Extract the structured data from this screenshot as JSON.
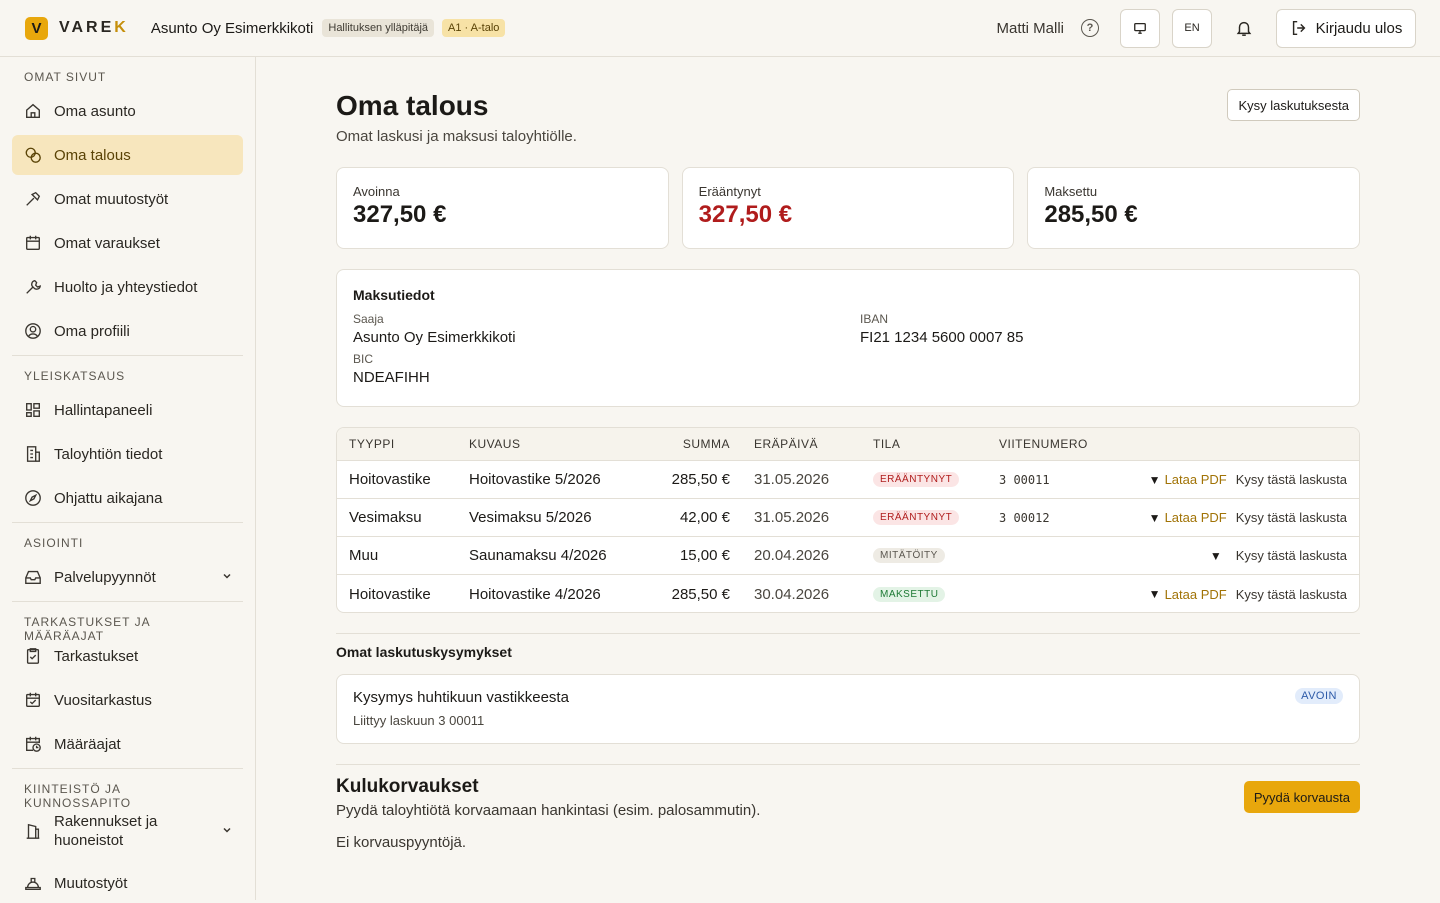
{
  "header": {
    "logo_letter": "V",
    "logo_text_main": "VARE",
    "logo_text_accent": "K",
    "org_name": "Asunto Oy Esimerkkikoti",
    "role_badge": "Hallituksen ylläpitäjä",
    "apartment_badge": "A1 · A-talo",
    "user_name": "Matti Malli",
    "help_icon": "?",
    "language": "EN",
    "logout_label": "Kirjaudu ulos"
  },
  "sidebar": {
    "sections": [
      {
        "title": "OMAT SIVUT",
        "items": [
          {
            "label": "Oma asunto",
            "icon": "home-icon"
          },
          {
            "label": "Oma talous",
            "icon": "coins-icon",
            "active": true
          },
          {
            "label": "Omat muutostyöt",
            "icon": "hammer-icon"
          },
          {
            "label": "Omat varaukset",
            "icon": "calendar-icon"
          },
          {
            "label": "Huolto ja yhteystiedot",
            "icon": "wrench-icon"
          },
          {
            "label": "Oma profiili",
            "icon": "user-circle-icon"
          }
        ]
      },
      {
        "title": "YLEISKATSAUS",
        "items": [
          {
            "label": "Hallintapaneeli",
            "icon": "dashboard-icon"
          },
          {
            "label": "Taloyhtiön tiedot",
            "icon": "building-icon"
          },
          {
            "label": "Ohjattu aikajana",
            "icon": "compass-icon"
          }
        ]
      },
      {
        "title": "ASIOINTI",
        "items": [
          {
            "label": "Palvelupyynnöt",
            "icon": "inbox-icon",
            "expandable": true
          }
        ]
      },
      {
        "title": "TARKASTUKSET JA MÄÄRÄAJAT",
        "items": [
          {
            "label": "Tarkastukset",
            "icon": "clipboard-check-icon"
          },
          {
            "label": "Vuositarkastus",
            "icon": "calendar-check-icon"
          },
          {
            "label": "Määräajat",
            "icon": "calendar-clock-icon"
          }
        ]
      },
      {
        "title": "KIINTEISTÖ JA KUNNOSSAPITO",
        "items": [
          {
            "label": "Rakennukset ja huoneistot",
            "icon": "building-door-icon",
            "expandable": true
          },
          {
            "label": "Muutostyöt",
            "icon": "hard-hat-icon"
          }
        ]
      }
    ]
  },
  "page": {
    "title": "Oma talous",
    "subtitle": "Omat laskusi ja maksusi taloyhtiölle.",
    "ask_button": "Kysy laskutuksesta"
  },
  "stats": [
    {
      "label": "Avoinna",
      "value": "327,50 €"
    },
    {
      "label": "Erääntynyt",
      "value": "327,50 €",
      "color": "#b01c1c"
    },
    {
      "label": "Maksettu",
      "value": "285,50 €"
    }
  ],
  "payment_info": {
    "title": "Maksutiedot",
    "recipient_label": "Saaja",
    "recipient": "Asunto Oy Esimerkkikoti",
    "iban_label": "IBAN",
    "iban": "FI21 1234 5600 0007 85",
    "bic_label": "BIC",
    "bic": "NDEAFIHH"
  },
  "invoices": {
    "columns": [
      "TYYPPI",
      "KUVAUS",
      "SUMMA",
      "ERÄPÄIVÄ",
      "TILA",
      "VIITENUMERO"
    ],
    "rows": [
      {
        "type": "Hoitovastike",
        "description": "Hoitovastike 5/2026",
        "amount": "285,50 €",
        "due": "31.05.2026",
        "status": "ERÄÄNTYNYT",
        "status_kind": "overdue",
        "reference": "3 00011",
        "pdf": "Lataa PDF",
        "ask": "Kysy tästä laskusta"
      },
      {
        "type": "Vesimaksu",
        "description": "Vesimaksu 5/2026",
        "amount": "42,00 €",
        "due": "31.05.2026",
        "status": "ERÄÄNTYNYT",
        "status_kind": "overdue",
        "reference": "3 00012",
        "pdf": "Lataa PDF",
        "ask": "Kysy tästä laskusta"
      },
      {
        "type": "Muu",
        "description": "Saunamaksu 4/2026",
        "amount": "15,00 €",
        "due": "20.04.2026",
        "status": "MITÄTÖITY",
        "status_kind": "void",
        "reference": "",
        "pdf": "",
        "ask": "Kysy tästä laskusta"
      },
      {
        "type": "Hoitovastike",
        "description": "Hoitovastike 4/2026",
        "amount": "285,50 €",
        "due": "30.04.2026",
        "status": "MAKSETTU",
        "status_kind": "paid",
        "reference": "",
        "pdf": "Lataa PDF",
        "ask": "Kysy tästä laskusta"
      }
    ]
  },
  "questions": {
    "title": "Omat laskutuskysymykset",
    "items": [
      {
        "title": "Kysymys huhtikuun vastikkeesta",
        "subtitle": "Liittyy laskuun 3 00011",
        "status": "AVOIN"
      }
    ]
  },
  "expenses": {
    "title": "Kulukorvaukset",
    "subtitle": "Pyydä taloyhtiötä korvaamaan hankintasi (esim. palosammutin).",
    "empty_text": "Ei korvauspyyntöjä.",
    "request_button": "Pyydä korvausta"
  },
  "colors": {
    "accent": "#e8a70c",
    "active_nav_bg": "#f7e6bd",
    "overdue": "#b01c1c",
    "paid": "#1e7a35",
    "open_badge": "#2d5aa8"
  }
}
